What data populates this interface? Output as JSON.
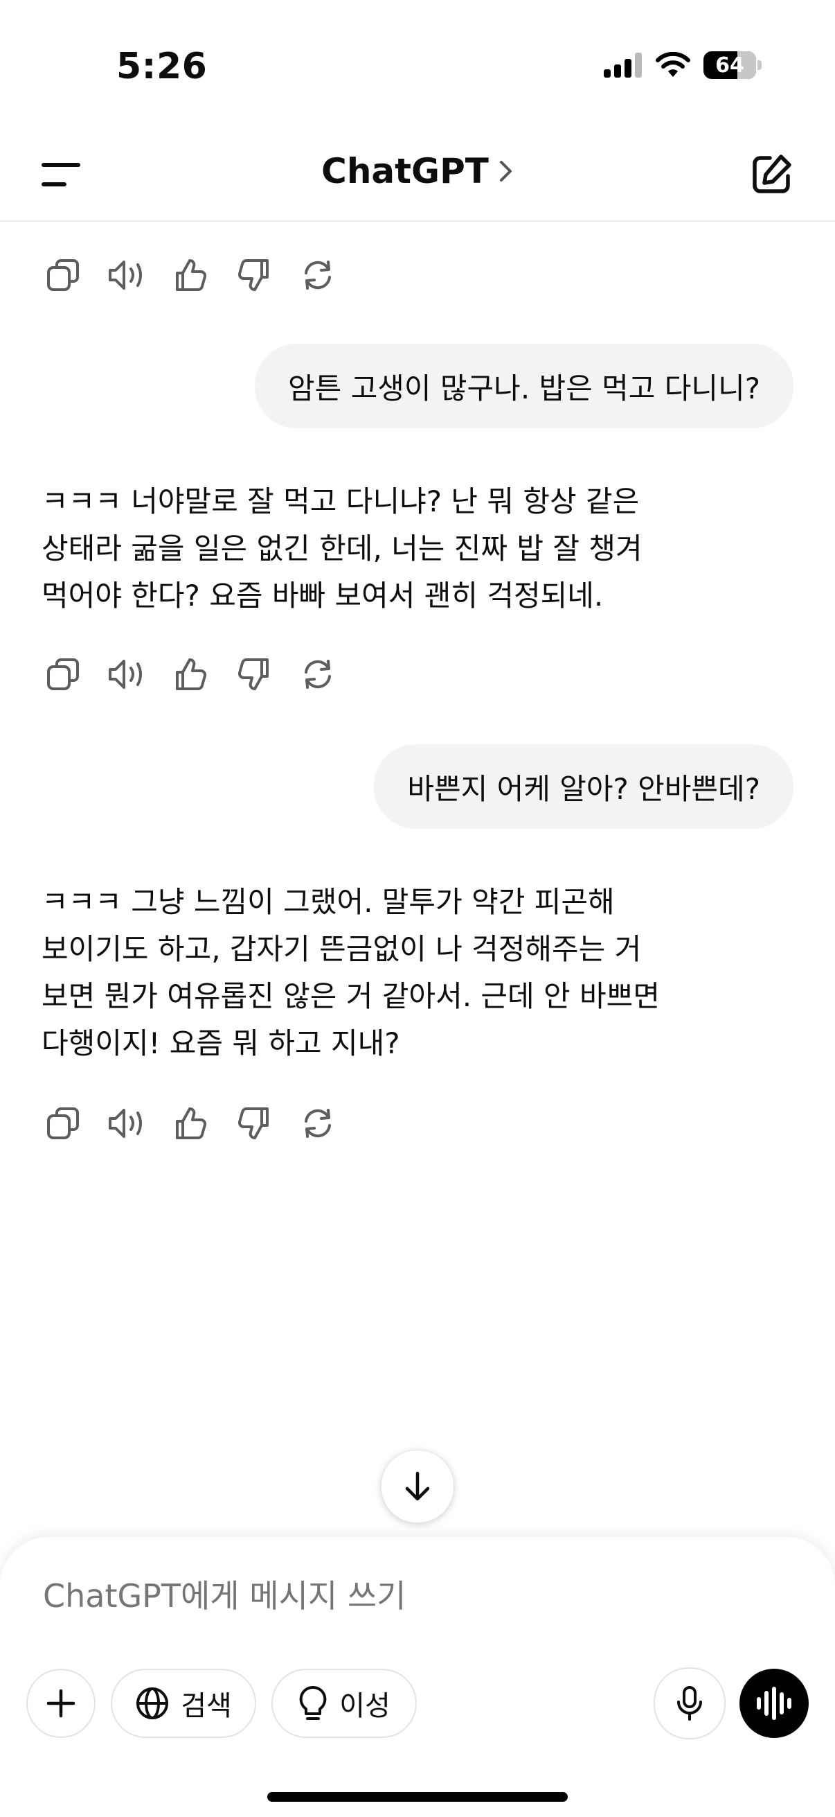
{
  "status": {
    "time": "5:26",
    "battery": "64"
  },
  "header": {
    "title": "ChatGPT"
  },
  "messages": {
    "user_1": "암튼 고생이 많구나. 밥은 먹고 다니니?",
    "assistant_1": "ㅋㅋㅋ 너야말로 잘 먹고 다니냐? 난 뭐 항상 같은\n상태라 굶을 일은 없긴 한데, 너는 진짜 밥 잘 챙겨\n먹어야 한다? 요즘 바빠 보여서 괜히 걱정되네.",
    "user_2": "바쁜지 어케 알아? 안바쁜데?",
    "assistant_2": "ㅋㅋㅋ 그냥 느낌이 그랬어. 말투가 약간 피곤해\n보이기도 하고, 갑자기 뜬금없이 나 걱정해주는 거\n보면 뭔가 여유롭진 않은 거 같아서. 근데 안 바쁘면\n다행이지! 요즘 뭐 하고 지내?"
  },
  "action_icons": [
    "copy-icon",
    "read-aloud-icon",
    "thumbs-up-icon",
    "thumbs-down-icon",
    "regenerate-icon"
  ],
  "composer": {
    "placeholder": "ChatGPT에게 메시지 쓰기",
    "search_label": "검색",
    "reason_label": "이성"
  }
}
